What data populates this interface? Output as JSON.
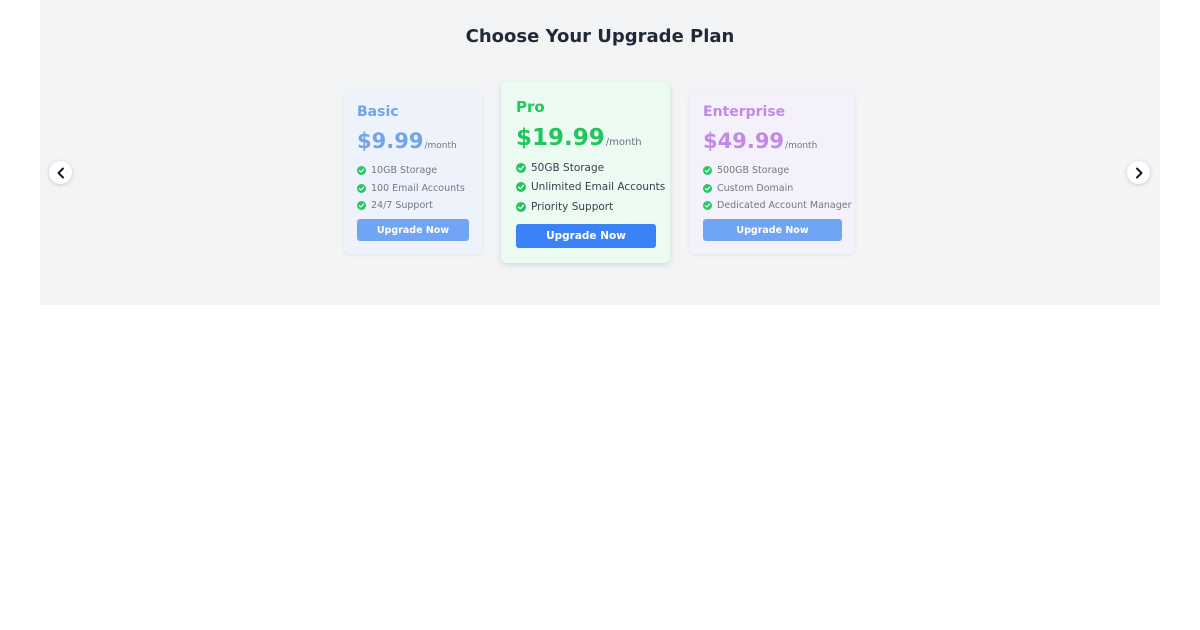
{
  "page": {
    "title": "Choose Your Upgrade Plan"
  },
  "carousel": {
    "prev_icon": "chevron-left-icon",
    "next_icon": "chevron-right-icon"
  },
  "plans": [
    {
      "name": "Basic",
      "price": "$9.99",
      "period": "/month",
      "accent_color": "#6aa0ee",
      "features": [
        "10GB Storage",
        "100 Email Accounts",
        "24/7 Support"
      ],
      "button_label": "Upgrade Now",
      "button_color": "#6aa0f5",
      "highlighted": false
    },
    {
      "name": "Pro",
      "price": "$19.99",
      "period": "/month",
      "accent_color": "#22c55e",
      "features": [
        "50GB Storage",
        "Unlimited Email Accounts",
        "Priority Support"
      ],
      "button_label": "Upgrade Now",
      "button_color": "#3b82f6",
      "highlighted": true
    },
    {
      "name": "Enterprise",
      "price": "$49.99",
      "period": "/month",
      "accent_color": "#c084e8",
      "features": [
        "500GB Storage",
        "Custom Domain",
        "Dedicated Account Manager"
      ],
      "button_label": "Upgrade Now",
      "button_color": "#6aa0f5",
      "highlighted": false
    }
  ],
  "colors": {
    "panel_background": "#f3f4f6",
    "check_icon": "#22c55e",
    "title_text": "#1f2937"
  }
}
